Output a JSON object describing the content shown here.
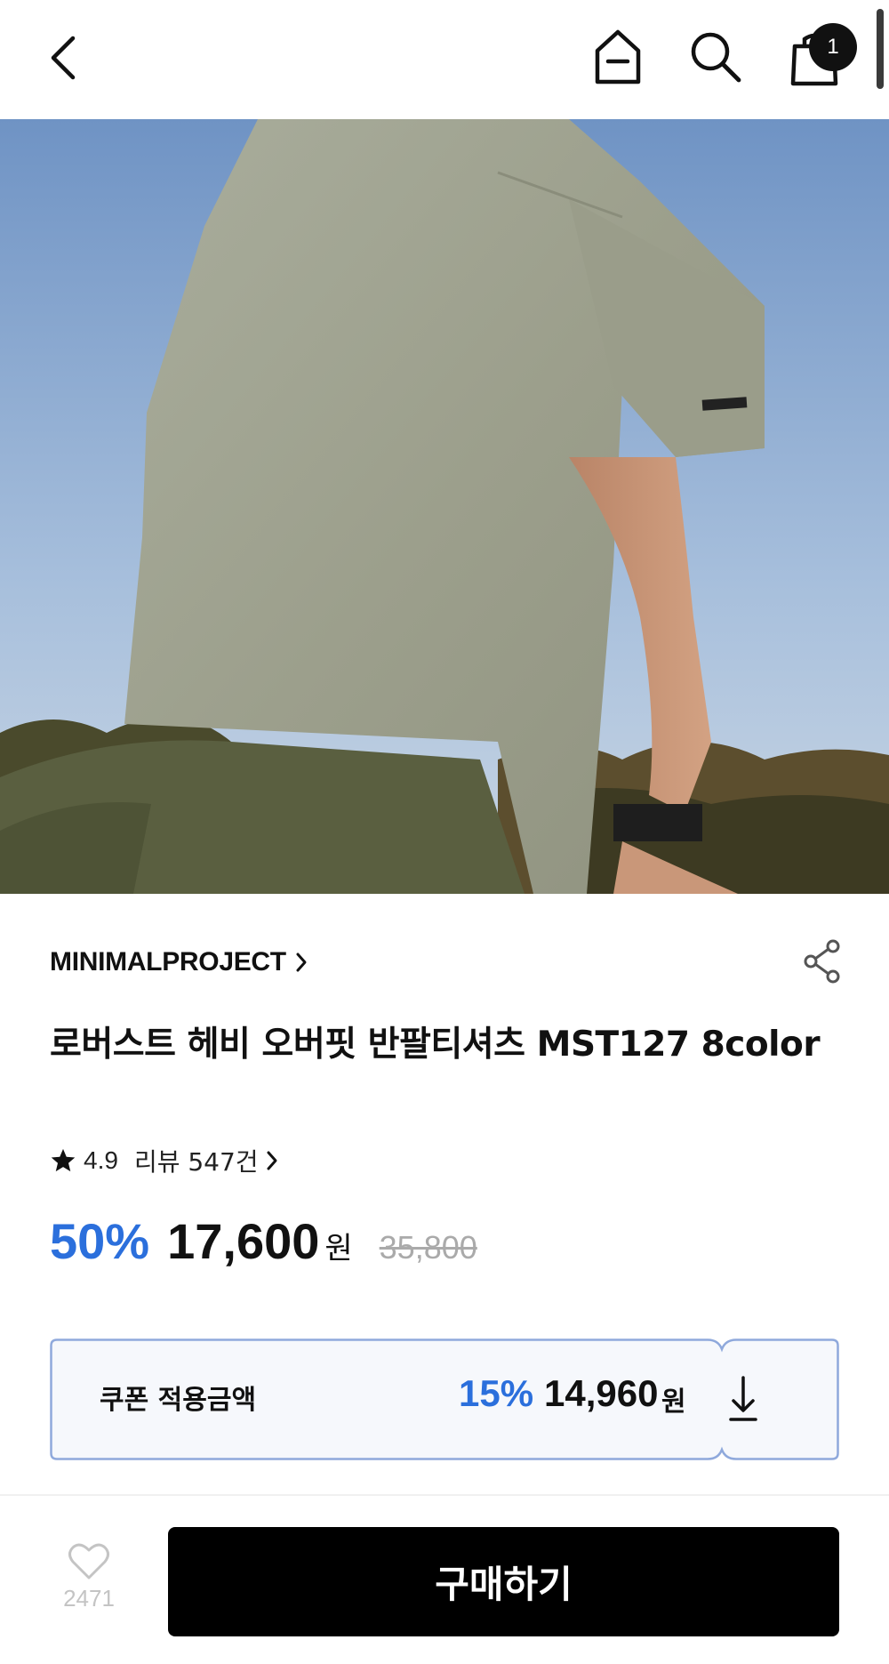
{
  "header": {
    "back_icon": "chevron-left-icon",
    "home_icon": "home-icon",
    "search_icon": "search-icon",
    "cart_icon": "shopping-bag-icon",
    "cart_count": "1"
  },
  "hero": {
    "image": "product-photo"
  },
  "product": {
    "brand": "MINIMALPROJECT",
    "title": "로버스트 헤비 오버핏 반팔티셔츠 MST127 8color",
    "rating": "4.9",
    "review_label": "리뷰 547건",
    "discount": "50%",
    "price": "17,600",
    "currency": "원",
    "original_price": "35,800"
  },
  "coupon": {
    "label": "쿠폰 적용금액",
    "discount": "15%",
    "price": "14,960",
    "currency": "원",
    "download_icon": "download-icon"
  },
  "bottom_bar": {
    "like_count": "2471",
    "buy_label": "구매하기"
  },
  "colors": {
    "accent": "#2b6fdc",
    "coupon_border": "#8fa9dc",
    "coupon_bg": "#f6f8fc"
  }
}
